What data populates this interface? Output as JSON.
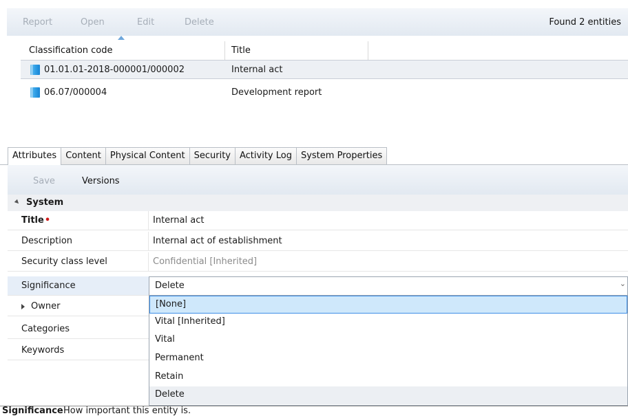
{
  "toolbar": {
    "report_label": "Report",
    "open_label": "Open",
    "edit_label": "Edit",
    "delete_label": "Delete",
    "found_text": "Found 2 entities"
  },
  "list": {
    "columns": [
      "Classification code",
      "Title"
    ],
    "rows": [
      {
        "code": "01.01.01-2018-000001/000002",
        "title": "Internal act",
        "selected": true
      },
      {
        "code": "06.07/000004",
        "title": "Development report",
        "selected": false
      }
    ]
  },
  "tabs": [
    "Attributes",
    "Content",
    "Physical Content",
    "Security",
    "Activity Log",
    "System Properties"
  ],
  "details_toolbar": {
    "save_label": "Save",
    "versions_label": "Versions"
  },
  "properties": {
    "group_label": "System",
    "rows": [
      {
        "name": "Title",
        "value": "Internal act",
        "required": true
      },
      {
        "name": "Description",
        "value": "Internal act of establishment"
      },
      {
        "name": "Security class level",
        "value": "Confidential [Inherited]"
      },
      {
        "name": "Significance",
        "value": "Delete"
      },
      {
        "name": "Owner",
        "value": ""
      },
      {
        "name": "Categories",
        "value": ""
      },
      {
        "name": "Keywords",
        "value": ""
      }
    ]
  },
  "significance_dropdown": {
    "selected": "Delete",
    "options": [
      "[None]",
      "Vital [Inherited]",
      "Vital",
      "Permanent",
      "Retain",
      "Delete"
    ],
    "highlighted": "[None]"
  },
  "status": {
    "label": "Significance",
    "description": "How important this entity is."
  },
  "colors": {
    "toolbar_bg": "#e2e9f1",
    "disabled_text": "#a6aeb8",
    "highlight_bg": "#cfe8fb",
    "highlight_border": "#3d8ee6",
    "required_marker": "#d01c1c"
  },
  "icons": [
    "sort-ascending-icon",
    "document-icon",
    "collapse-triangle-icon",
    "expand-triangle-icon",
    "chevron-down-icon"
  ]
}
